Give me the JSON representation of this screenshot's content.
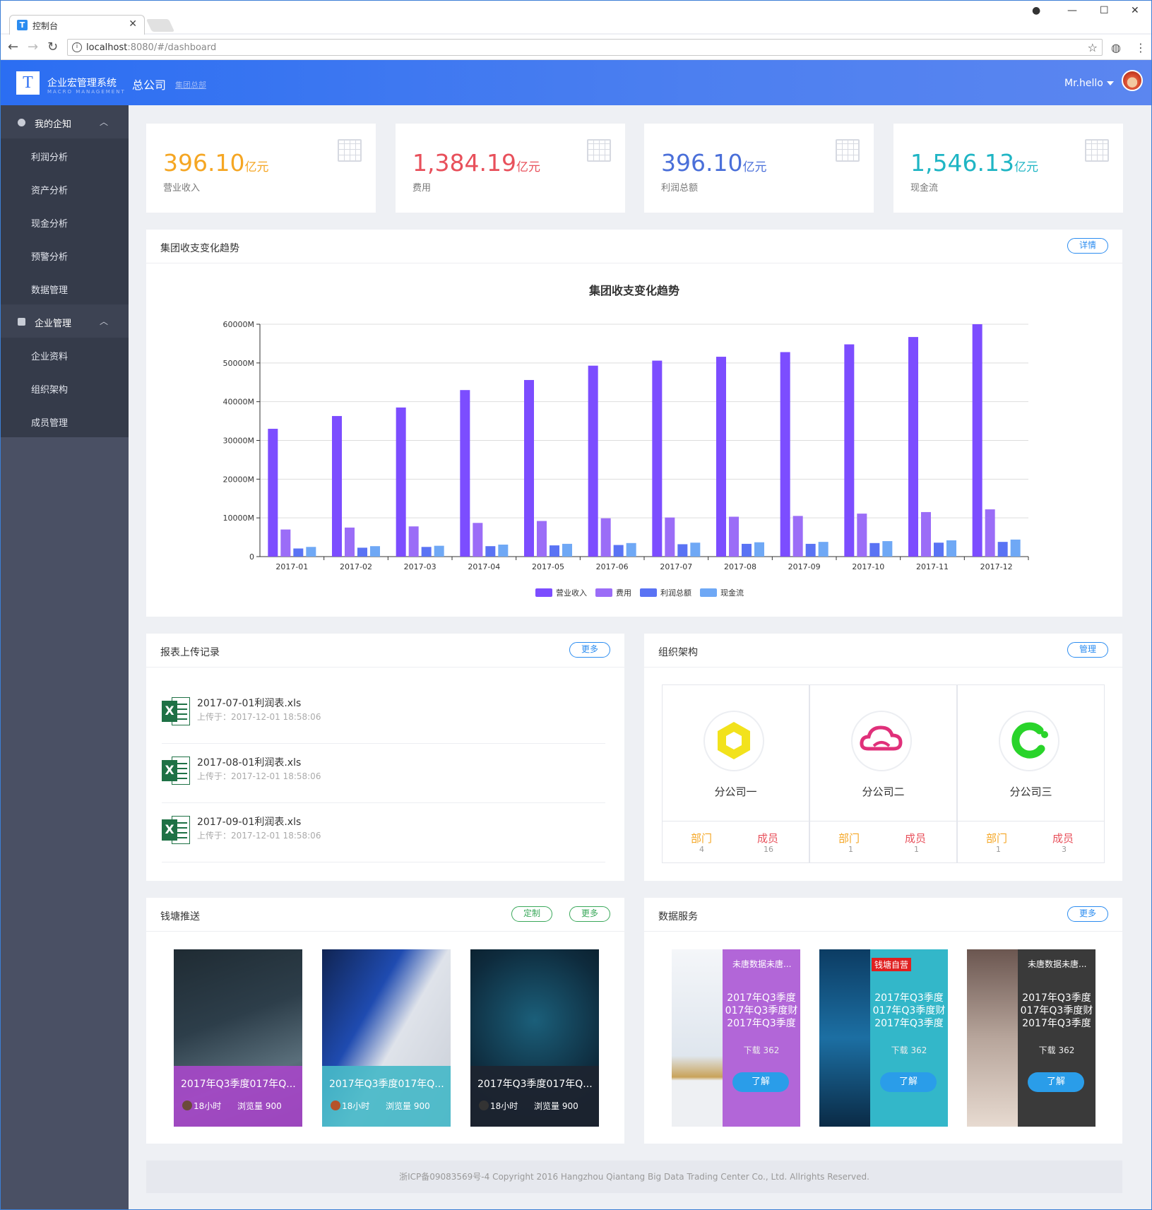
{
  "browser": {
    "tab_title": "控制台",
    "url_host": "localhost",
    "url_path": ":8080/#/dashboard"
  },
  "header": {
    "brand": "企业宏管理系统",
    "brand_sub": "MACRO MANAGEMENT",
    "company": "总公司",
    "company_sub": "集团总部",
    "user": "Mr.hello",
    "logo_letter": "T"
  },
  "sidebar": {
    "group1": "我的企知",
    "items1": [
      "利润分析",
      "资产分析",
      "现金分析",
      "预警分析",
      "数据管理"
    ],
    "group2": "企业管理",
    "items2": [
      "企业资料",
      "组织架构",
      "成员管理"
    ]
  },
  "kpis": [
    {
      "value": "396.10",
      "unit": "亿元",
      "label": "营业收入",
      "color": "#f5a623"
    },
    {
      "value": "1,384.19",
      "unit": "亿元",
      "label": "费用",
      "color": "#e8505b"
    },
    {
      "value": "396.10",
      "unit": "亿元",
      "label": "利润总额",
      "color": "#4a6fd9"
    },
    {
      "value": "1,546.13",
      "unit": "亿元",
      "label": "现金流",
      "color": "#1fb5c4"
    }
  ],
  "trend_panel": {
    "title": "集团收支变化趋势",
    "button": "详情"
  },
  "chart_data": {
    "type": "bar",
    "title": "集团收支变化趋势",
    "categories": [
      "2017-01",
      "2017-02",
      "2017-03",
      "2017-04",
      "2017-05",
      "2017-06",
      "2017-07",
      "2017-08",
      "2017-09",
      "2017-10",
      "2017-11",
      "2017-12"
    ],
    "yticks": [
      "0",
      "10000M",
      "20000M",
      "30000M",
      "40000M",
      "50000M",
      "60000M"
    ],
    "ylim": [
      0,
      60000
    ],
    "grid": true,
    "legend_position": "bottom",
    "series": [
      {
        "name": "营业收入",
        "color": "#7c4dff",
        "values": [
          33000,
          36300,
          38500,
          43000,
          45600,
          49300,
          50600,
          51600,
          52800,
          54800,
          56700,
          60000
        ]
      },
      {
        "name": "费用",
        "color": "#9b6df7",
        "values": [
          7000,
          7500,
          7800,
          8700,
          9200,
          9900,
          10100,
          10300,
          10500,
          11100,
          11500,
          12200
        ]
      },
      {
        "name": "利润总额",
        "color": "#5a73f4",
        "values": [
          2100,
          2300,
          2500,
          2700,
          2900,
          3000,
          3200,
          3300,
          3300,
          3500,
          3600,
          3800
        ]
      },
      {
        "name": "现金流",
        "color": "#6fa8f5",
        "values": [
          2500,
          2700,
          2800,
          3100,
          3300,
          3500,
          3600,
          3700,
          3800,
          4000,
          4200,
          4400
        ]
      }
    ]
  },
  "upload_panel": {
    "title": "报表上传记录",
    "button": "更多",
    "files": [
      {
        "name": "2017-07-01利润表.xls",
        "date": "上传于：2017-12-01 18:58:06"
      },
      {
        "name": "2017-08-01利润表.xls",
        "date": "上传于：2017-12-01 18:58:06"
      },
      {
        "name": "2017-09-01利润表.xls",
        "date": "上传于：2017-12-01 18:58:06"
      }
    ]
  },
  "org_panel": {
    "title": "组织架构",
    "button": "管理",
    "dept_label": "部门",
    "member_label": "成员",
    "orgs": [
      {
        "name": "分公司一",
        "dept": "4",
        "members": "16"
      },
      {
        "name": "分公司二",
        "dept": "1",
        "members": "1"
      },
      {
        "name": "分公司三",
        "dept": "1",
        "members": "3"
      }
    ]
  },
  "push_panel": {
    "title": "钱塘推送",
    "button1": "定制",
    "button2": "更多",
    "cards": [
      {
        "title": "2017年Q3季度017年Q...",
        "time": "18小时",
        "views": "浏览量 900",
        "color": "#a648c8"
      },
      {
        "title": "2017年Q3季度017年Q...",
        "time": "18小时",
        "views": "浏览量 900",
        "color": "#47b8c8"
      },
      {
        "title": "2017年Q3季度017年Q...",
        "time": "18小时",
        "views": "浏览量 900",
        "color": "#1d2430"
      }
    ]
  },
  "data_panel": {
    "title": "数据服务",
    "button": "更多",
    "cards": [
      {
        "tag": "未唐数据未唐...",
        "text1": "2017年Q3季度",
        "text2": "017年Q3季度财",
        "text3": "2017年Q3季度",
        "downloads": "下载 362",
        "action": "了解",
        "color": "#b266d8"
      },
      {
        "tag": "钱塘自营",
        "text1": "2017年Q3季度",
        "text2": "017年Q3季度财",
        "text3": "2017年Q3季度",
        "downloads": "下载 362",
        "action": "了解",
        "color": "#33b7c9"
      },
      {
        "tag": "未唐数据未唐...",
        "text1": "2017年Q3季度",
        "text2": "017年Q3季度财",
        "text3": "2017年Q3季度",
        "downloads": "下载 362",
        "action": "了解",
        "color": "#3a3a3a"
      }
    ]
  },
  "footer": "浙ICP备09083569号-4 Copyright 2016 Hangzhou Qiantang Big Data Trading Center Co., Ltd. Allrights Reserved."
}
